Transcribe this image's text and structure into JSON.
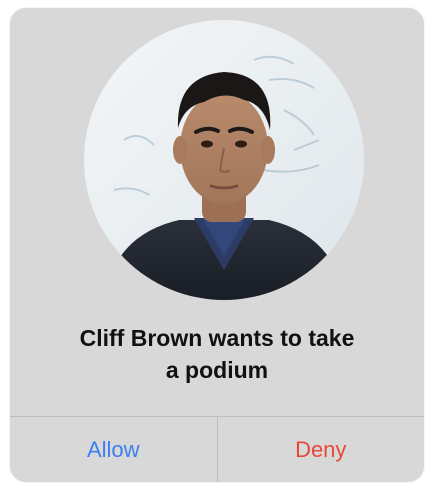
{
  "dialog": {
    "avatar": {
      "icon": "person-photo",
      "description": "circular profile photo"
    },
    "message_lines": [
      "Cliff Brown wants to take",
      "a podium"
    ],
    "buttons": {
      "allow_label": "Allow",
      "deny_label": "Deny"
    }
  },
  "colors": {
    "dialog_background": "#d8d8d8",
    "allow": "#3b7ff0",
    "deny": "#e8483a",
    "divider": "#bdbdbd"
  }
}
